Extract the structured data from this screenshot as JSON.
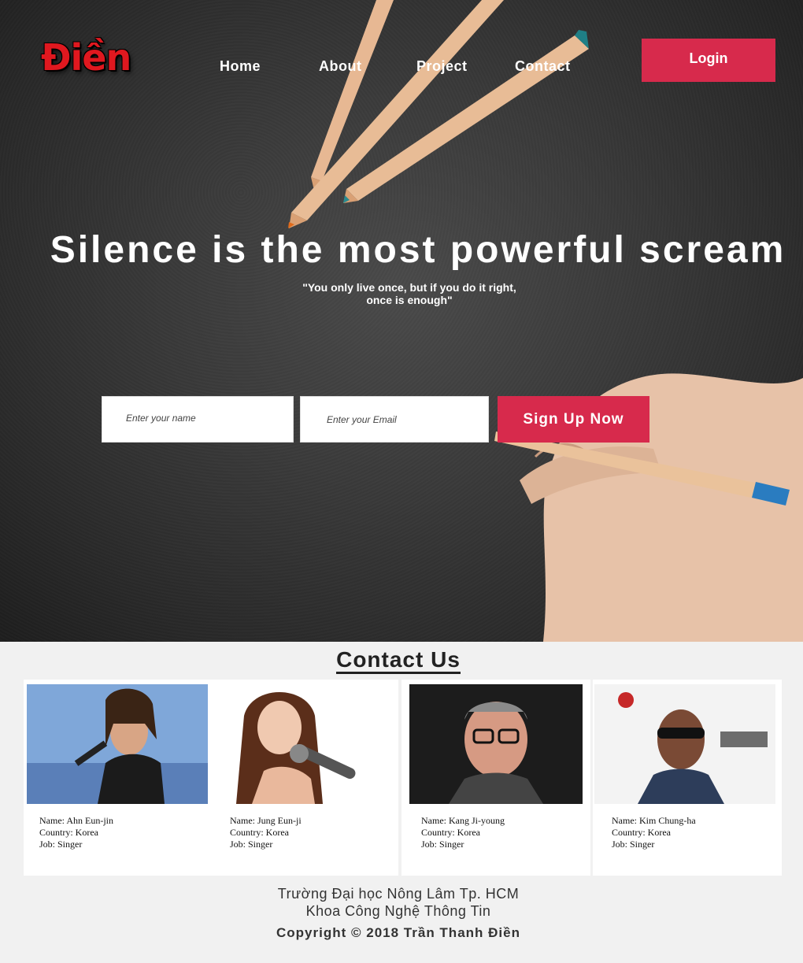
{
  "brand": {
    "logo_text": "Điền"
  },
  "nav": {
    "items": [
      {
        "label": "Home"
      },
      {
        "label": "About"
      },
      {
        "label": "Project"
      },
      {
        "label": "Contact"
      }
    ],
    "login_label": "Login"
  },
  "hero": {
    "headline": "Silence is the most powerful scream",
    "quote_line1": "\"You only live once, but if you do it right,",
    "quote_line2": "once is enough\""
  },
  "signup": {
    "name_placeholder": "Enter your name",
    "email_placeholder": "Enter your Email",
    "button_label": "Sign Up Now"
  },
  "contact": {
    "title": "Contact Us",
    "people": [
      {
        "name": "Name: Ahn Eun-jin",
        "country": "Country: Korea",
        "job": "Job: Singer"
      },
      {
        "name": "Name: Jung Eun-ji",
        "country": "Country: Korea",
        "job": "Job: Singer"
      },
      {
        "name": "Name: Kang Ji-young",
        "country": "Country: Korea",
        "job": "Job: Singer"
      },
      {
        "name": "Name: Kim Chung-ha",
        "country": "Country: Korea",
        "job": "Job: Singer"
      }
    ]
  },
  "footer": {
    "line1": "Trường Đại học Nông Lâm Tp. HCM",
    "line2": "Khoa Công Nghệ Thông Tin",
    "copyright": "Copyright © 2018 Trần Thanh Điền"
  },
  "colors": {
    "accent": "#d72a4c",
    "hero_bg": "#333333",
    "page_bg": "#f1f1f1"
  }
}
